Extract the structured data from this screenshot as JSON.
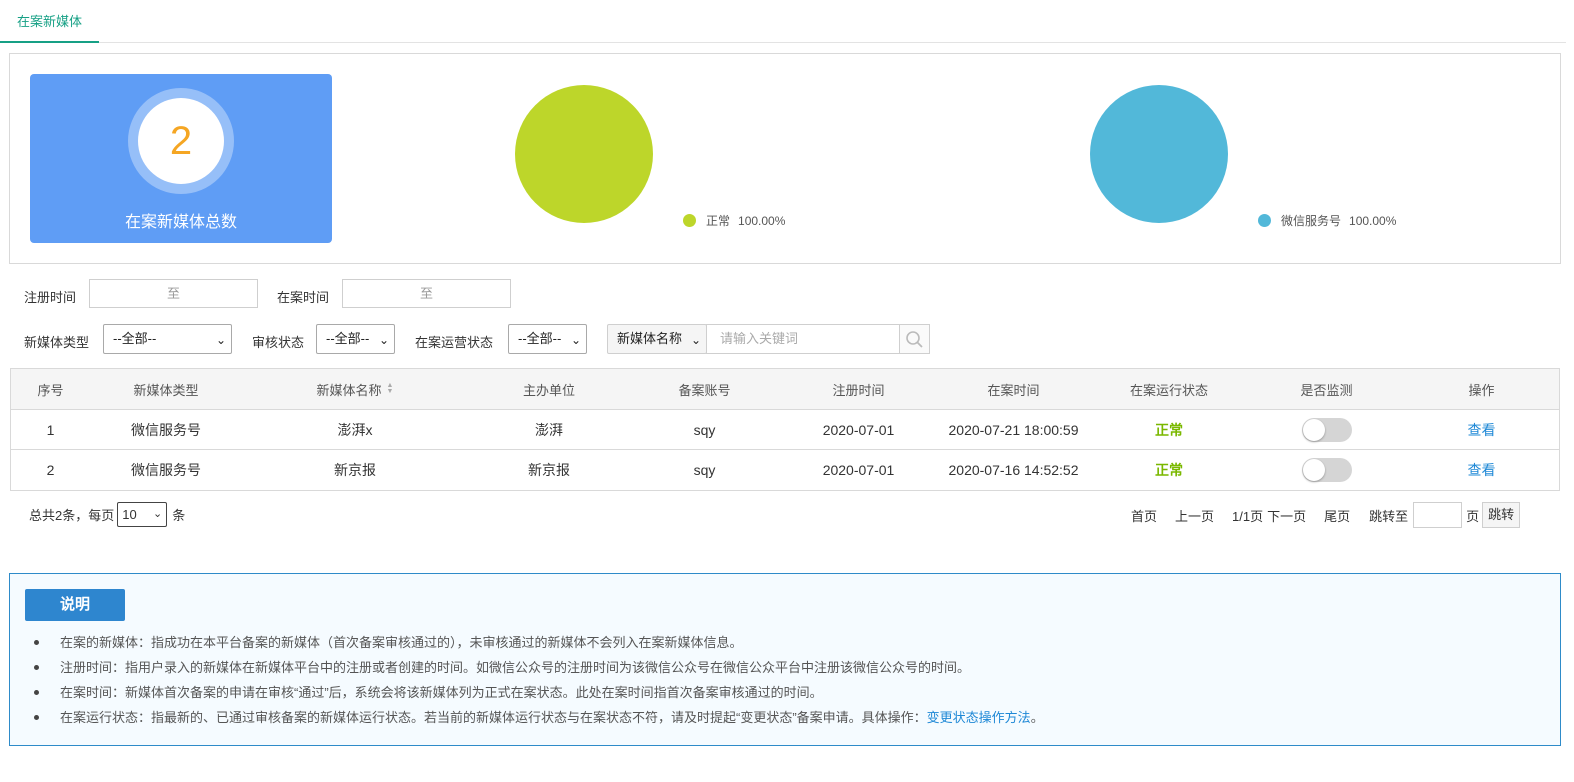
{
  "tabs": [
    {
      "label": "在案新媒体"
    }
  ],
  "stats": {
    "total_value": "2",
    "total_label": "在案新媒体总数",
    "status_pie": {
      "legend": "正常",
      "percent": "100.00%",
      "color": "#bdd62a"
    },
    "type_pie": {
      "legend": "微信服务号",
      "percent": "100.00%",
      "color": "#52b8d9"
    }
  },
  "chart_data": [
    {
      "type": "pie",
      "categories": [
        "正常"
      ],
      "values": [
        100.0
      ],
      "colors": [
        "#bdd62a"
      ]
    },
    {
      "type": "pie",
      "categories": [
        "微信服务号"
      ],
      "values": [
        100.0
      ],
      "colors": [
        "#52b8d9"
      ]
    }
  ],
  "filters": {
    "reg_time_label": "注册时间",
    "reg_time_sep": "至",
    "record_time_label": "在案时间",
    "record_time_sep": "至",
    "media_type_label": "新媒体类型",
    "media_type_value": "--全部--",
    "audit_label": "审核状态",
    "audit_value": "--全部--",
    "operate_label": "在案运营状态",
    "operate_value": "--全部--",
    "search_field_value": "新媒体名称",
    "search_placeholder": "请输入关键词"
  },
  "table": {
    "columns": [
      "序号",
      "新媒体类型",
      "新媒体名称",
      "主办单位",
      "备案账号",
      "注册时间",
      "在案时间",
      "在案运行状态",
      "是否监测",
      "操作"
    ],
    "rows": [
      {
        "no": "1",
        "type": "微信服务号",
        "name": "澎湃x",
        "org": "澎湃",
        "account": "sqy",
        "reg": "2020-07-01",
        "record": "2020-07-21 18:00:59",
        "status": "正常",
        "monitor": false,
        "action": "查看"
      },
      {
        "no": "2",
        "type": "微信服务号",
        "name": "新京报",
        "org": "新京报",
        "account": "sqy",
        "reg": "2020-07-01",
        "record": "2020-07-16 14:52:52",
        "status": "正常",
        "monitor": false,
        "action": "查看"
      }
    ]
  },
  "pagination": {
    "total_prefix": "总共2条，每页",
    "page_size": "10",
    "unit": "条",
    "first": "首页",
    "prev": "上一页",
    "page_info": "1/1页",
    "next": "下一页",
    "last": "尾页",
    "jump_to": "跳转至",
    "page_unit": "页",
    "jump_btn": "跳转"
  },
  "notes": {
    "title": "说明",
    "items": [
      "在案的新媒体：指成功在本平台备案的新媒体（首次备案审核通过的），未审核通过的新媒体不会列入在案新媒体信息。",
      "注册时间：指用户录入的新媒体在新媒体平台中的注册或者创建的时间。如微信公众号的注册时间为该微信公众号在微信公众平台中注册该微信公众号的时间。",
      "在案时间：新媒体首次备案的申请在审核“通过”后，系统会将该新媒体列为正式在案状态。此处在案时间指首次备案审核通过的时间。",
      "在案运行状态：指最新的、已通过审核备案的新媒体运行状态。若当前的新媒体运行状态与在案状态不符，请及时提起“变更状态”备案申请。具体操作："
    ],
    "last_link": "变更状态操作方法",
    "last_suffix": "。"
  }
}
